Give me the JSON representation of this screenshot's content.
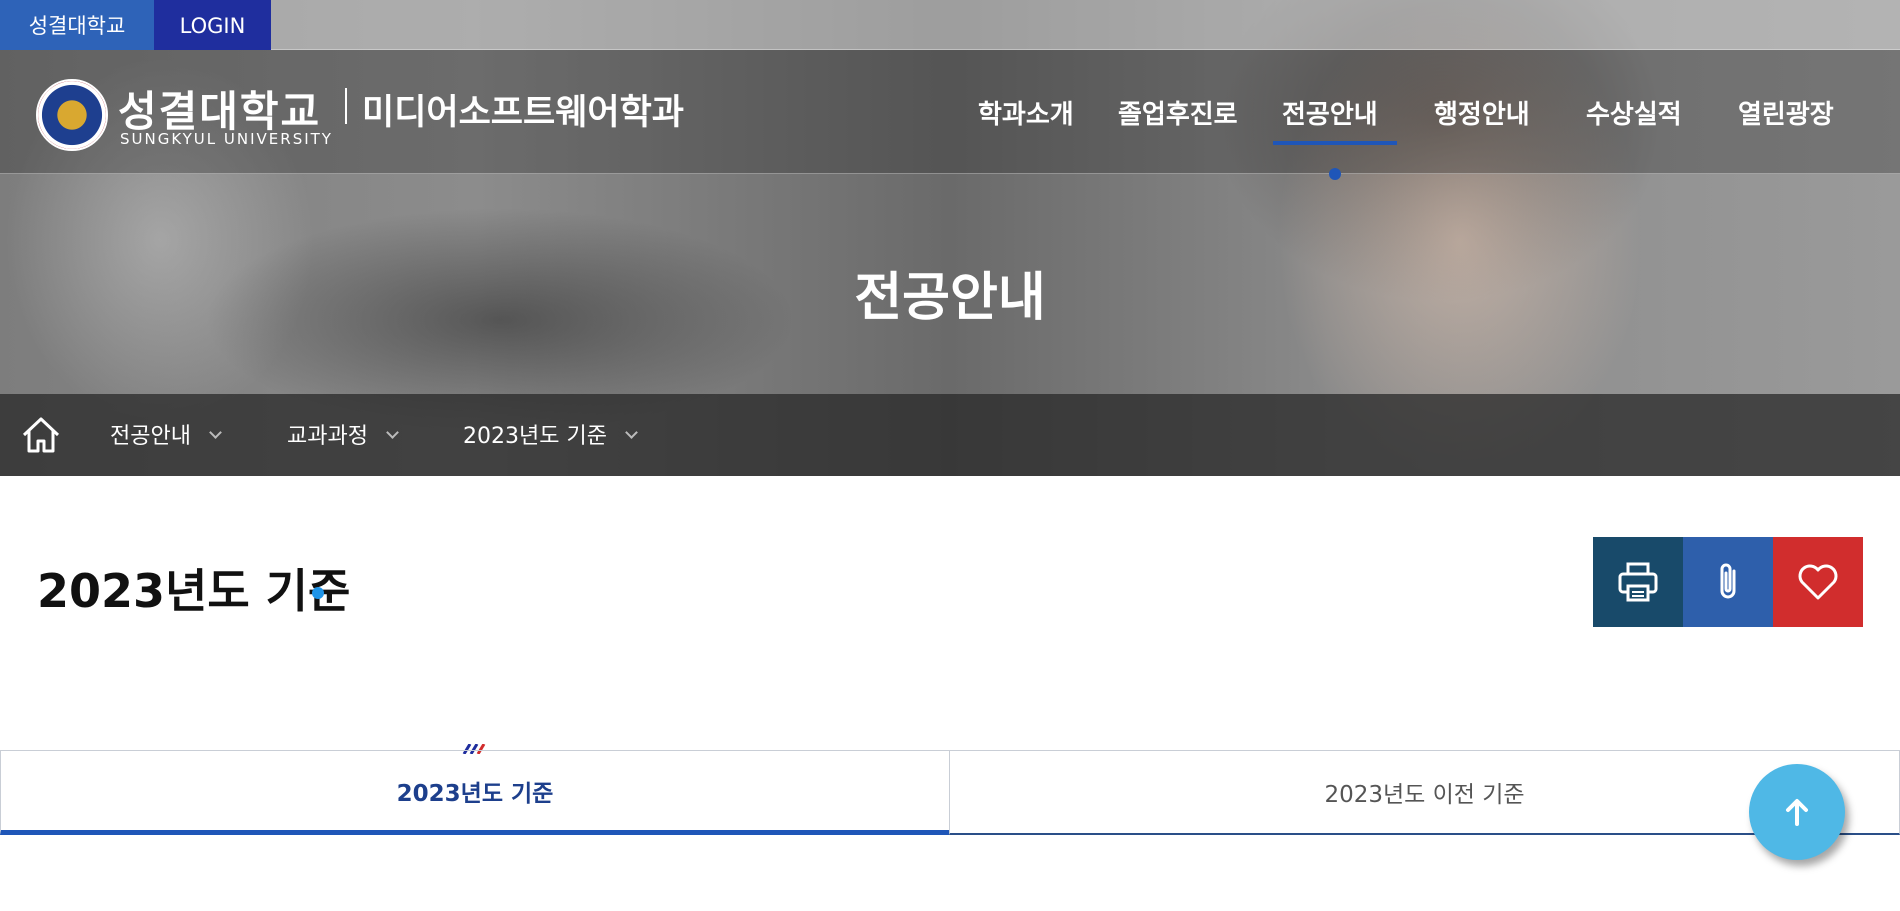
{
  "topbar": {
    "univ_label": "성결대학교",
    "login_label": "LOGIN"
  },
  "header": {
    "logo_kr": "성결대학교",
    "logo_en": "SUNGKYUL UNIVERSITY",
    "dept_name": "미디어소프트웨어학과",
    "nav": [
      {
        "label": "학과소개"
      },
      {
        "label": "졸업후진로"
      },
      {
        "label": "전공안내"
      },
      {
        "label": "행정안내"
      },
      {
        "label": "수상실적"
      },
      {
        "label": "열린광장"
      }
    ],
    "active_nav": "전공안내"
  },
  "hero": {
    "title": "전공안내"
  },
  "breadcrumb": {
    "items": [
      {
        "label": "전공안내"
      },
      {
        "label": "교과과정"
      },
      {
        "label": "2023년도 기준"
      }
    ]
  },
  "content": {
    "title": "2023년도 기준",
    "tabs": [
      {
        "label": "2023년도 기준",
        "active": true
      },
      {
        "label": "2023년도 이전 기준",
        "active": false
      }
    ]
  },
  "icons": {
    "home": "home-icon",
    "print": "print-icon",
    "attach": "paperclip-icon",
    "favorite": "heart-icon",
    "top": "arrow-up-icon"
  },
  "colors": {
    "primary": "#1f56b8",
    "login_bg": "#1f2e9e",
    "print_bg": "#184a6a",
    "attach_bg": "#2e5fab",
    "favorite_bg": "#d12d2d",
    "top_btn_bg": "#4fb8e6"
  }
}
